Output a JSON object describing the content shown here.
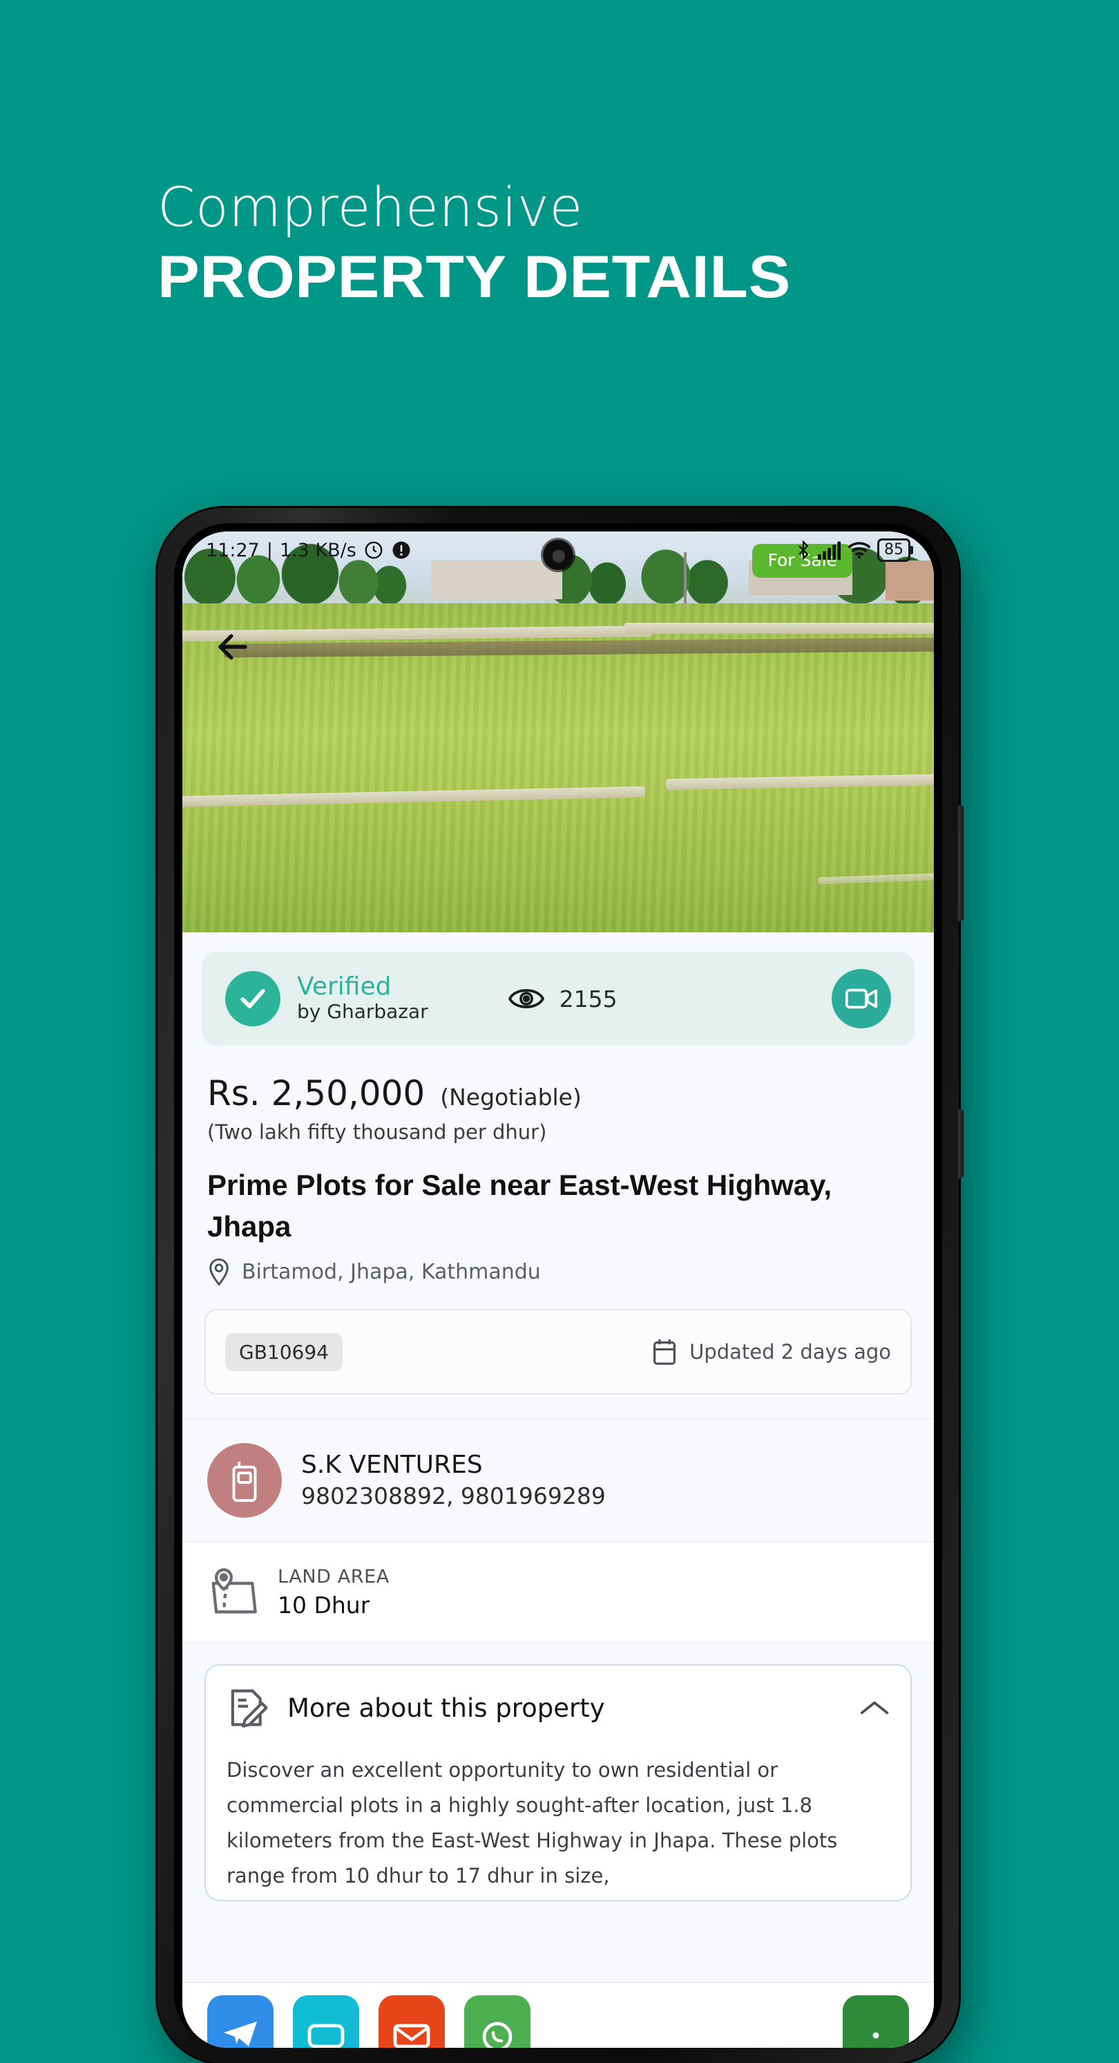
{
  "promo": {
    "line1": "Comprehensive",
    "line2": "PROPERTY DETAILS",
    "background_color": "#009688"
  },
  "status_bar": {
    "time": "11:27",
    "network_speed": "1.3 KB/s",
    "battery": "85",
    "icons": [
      "clock-icon",
      "info-icon",
      "bluetooth-icon",
      "cellular-signal-icon",
      "wifi-icon",
      "battery-icon"
    ]
  },
  "hero": {
    "back_label": "",
    "badge": "For Sale"
  },
  "verified": {
    "title": "Verified",
    "subtitle": "by Gharbazar",
    "views_count": "2155",
    "accent_color": "#2bb49a"
  },
  "price": {
    "amount": "Rs. 2,50,000",
    "negotiable": "(Negotiable)",
    "in_words": "(Two lakh fifty thousand per dhur)"
  },
  "listing": {
    "title": "Prime Plots for Sale near East-West Highway, Jhapa",
    "location": "Birtamod, Jhapa, Kathmandu",
    "id": "GB10694",
    "updated": "Updated 2 days ago"
  },
  "agent": {
    "name": "S.K VENTURES",
    "phones": "9802308892, 9801969289",
    "avatar_color": "#c0807f"
  },
  "land_area": {
    "label": "LAND AREA",
    "value": "10 Dhur"
  },
  "more_about": {
    "title": "More about this property",
    "description": "Discover an excellent opportunity to own residential or commercial plots in a highly sought-after location, just 1.8 kilometers from the East-West Highway in Jhapa. These plots range from 10 dhur to 17 dhur in size,"
  },
  "share_buttons": [
    {
      "name": "telegram",
      "color": "#2f8fe8"
    },
    {
      "name": "messenger",
      "color": "#0fbcd4"
    },
    {
      "name": "gmail",
      "color": "#e8441a"
    },
    {
      "name": "whatsapp",
      "color": "#4caf50"
    },
    {
      "name": "more",
      "color": "#2e8b39"
    }
  ]
}
